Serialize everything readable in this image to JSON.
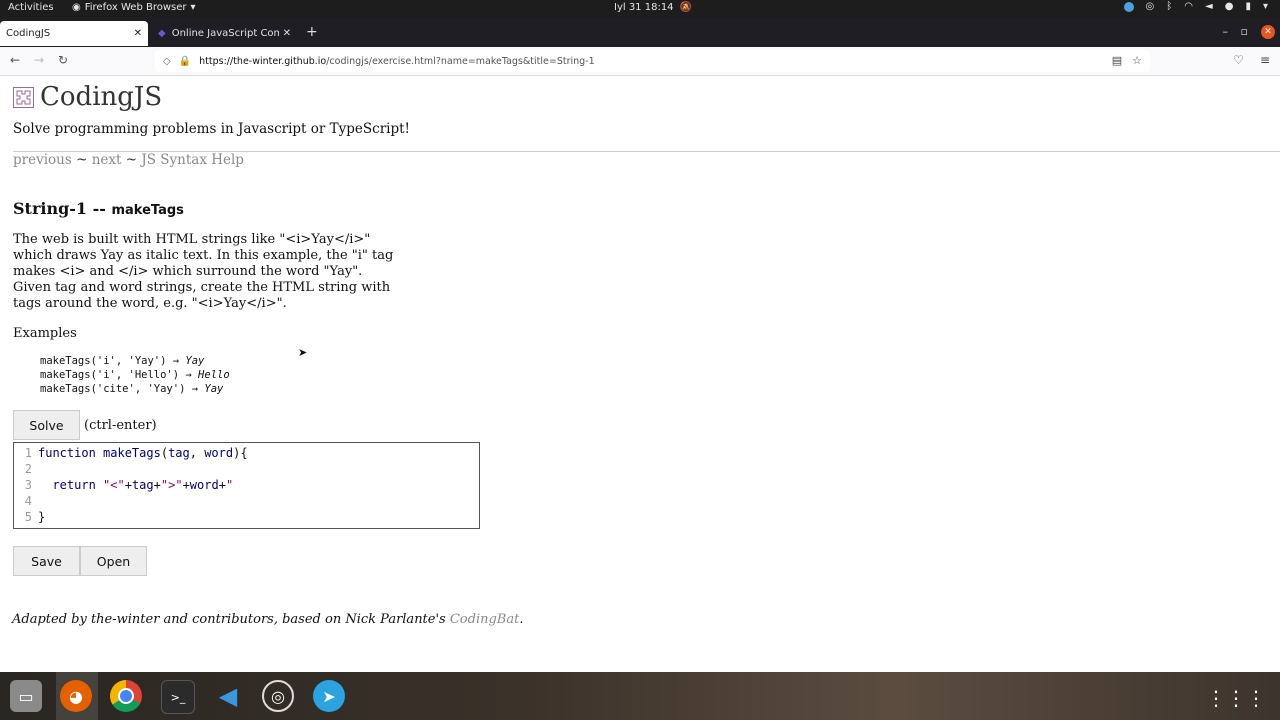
{
  "topbar": {
    "activities": "Activities",
    "app_menu": "Firefox Web Browser",
    "clock": "Iyl 31  18:14"
  },
  "tabs": [
    {
      "label": "CodingJS",
      "active": true
    },
    {
      "label": "Online JavaScript Compil",
      "active": false
    }
  ],
  "navbar": {
    "url_host": "https://the-winter.github.io",
    "url_path": "/codingjs/exercise.html?name=makeTags&title=String-1"
  },
  "page": {
    "site_title": "CodingJS",
    "tagline": "Solve programming problems in Javascript or TypeScript!",
    "nav": {
      "previous": "previous",
      "sep1": " ~ ",
      "next": "next",
      "sep2": " ~ ",
      "syntax": "JS Syntax Help"
    },
    "problem_group": "String-1 -- ",
    "problem_name": "makeTags",
    "description": [
      "The web is built with HTML strings like \"<i>Yay</i>\"",
      "which draws Yay as italic text. In this example, the \"i\" tag",
      "makes <i> and </i> which surround the word \"Yay\".",
      "Given tag and word strings, create the HTML string with",
      "tags around the word, e.g. \"<i>Yay</i>\"."
    ],
    "examples_label": "Examples",
    "examples": [
      {
        "call": "makeTags('i', 'Yay') → ",
        "result": "Yay"
      },
      {
        "call": "makeTags('i', 'Hello') → ",
        "result": "Hello"
      },
      {
        "call": "makeTags('cite', 'Yay') → ",
        "result": "Yay"
      }
    ],
    "solve_label": "Solve",
    "solve_hint": "(ctrl-enter)",
    "save_label": "Save",
    "open_label": "Open",
    "footer_text": "Adapted by the-winter and contributors, based on Nick Parlante's ",
    "footer_link": "CodingBat",
    "footer_end": "."
  },
  "editor": {
    "line_numbers": [
      "1",
      "2",
      "3",
      "4",
      "5"
    ],
    "line1": {
      "kw": "function ",
      "fn": "makeTags",
      "open": "(",
      "p1": "tag",
      "comma": ", ",
      "p2": "word",
      "close": "){"
    },
    "line3": {
      "kw": "return ",
      "s1": "\"<\"",
      "plus1": "+",
      "v1": "tag",
      "plus2": "+",
      "s2": "\">\"",
      "plus3": "+",
      "v2": "word",
      "plus4": "+",
      "s3": "\""
    },
    "line5": "}"
  },
  "dock": {
    "items": [
      "files-icon",
      "firefox-icon",
      "chrome-icon",
      "terminal-icon",
      "vscode-icon",
      "obs-icon",
      "telegram-icon"
    ]
  },
  "colors": {
    "accent_close": "#e95420",
    "link_grey": "#8a8a8a"
  }
}
